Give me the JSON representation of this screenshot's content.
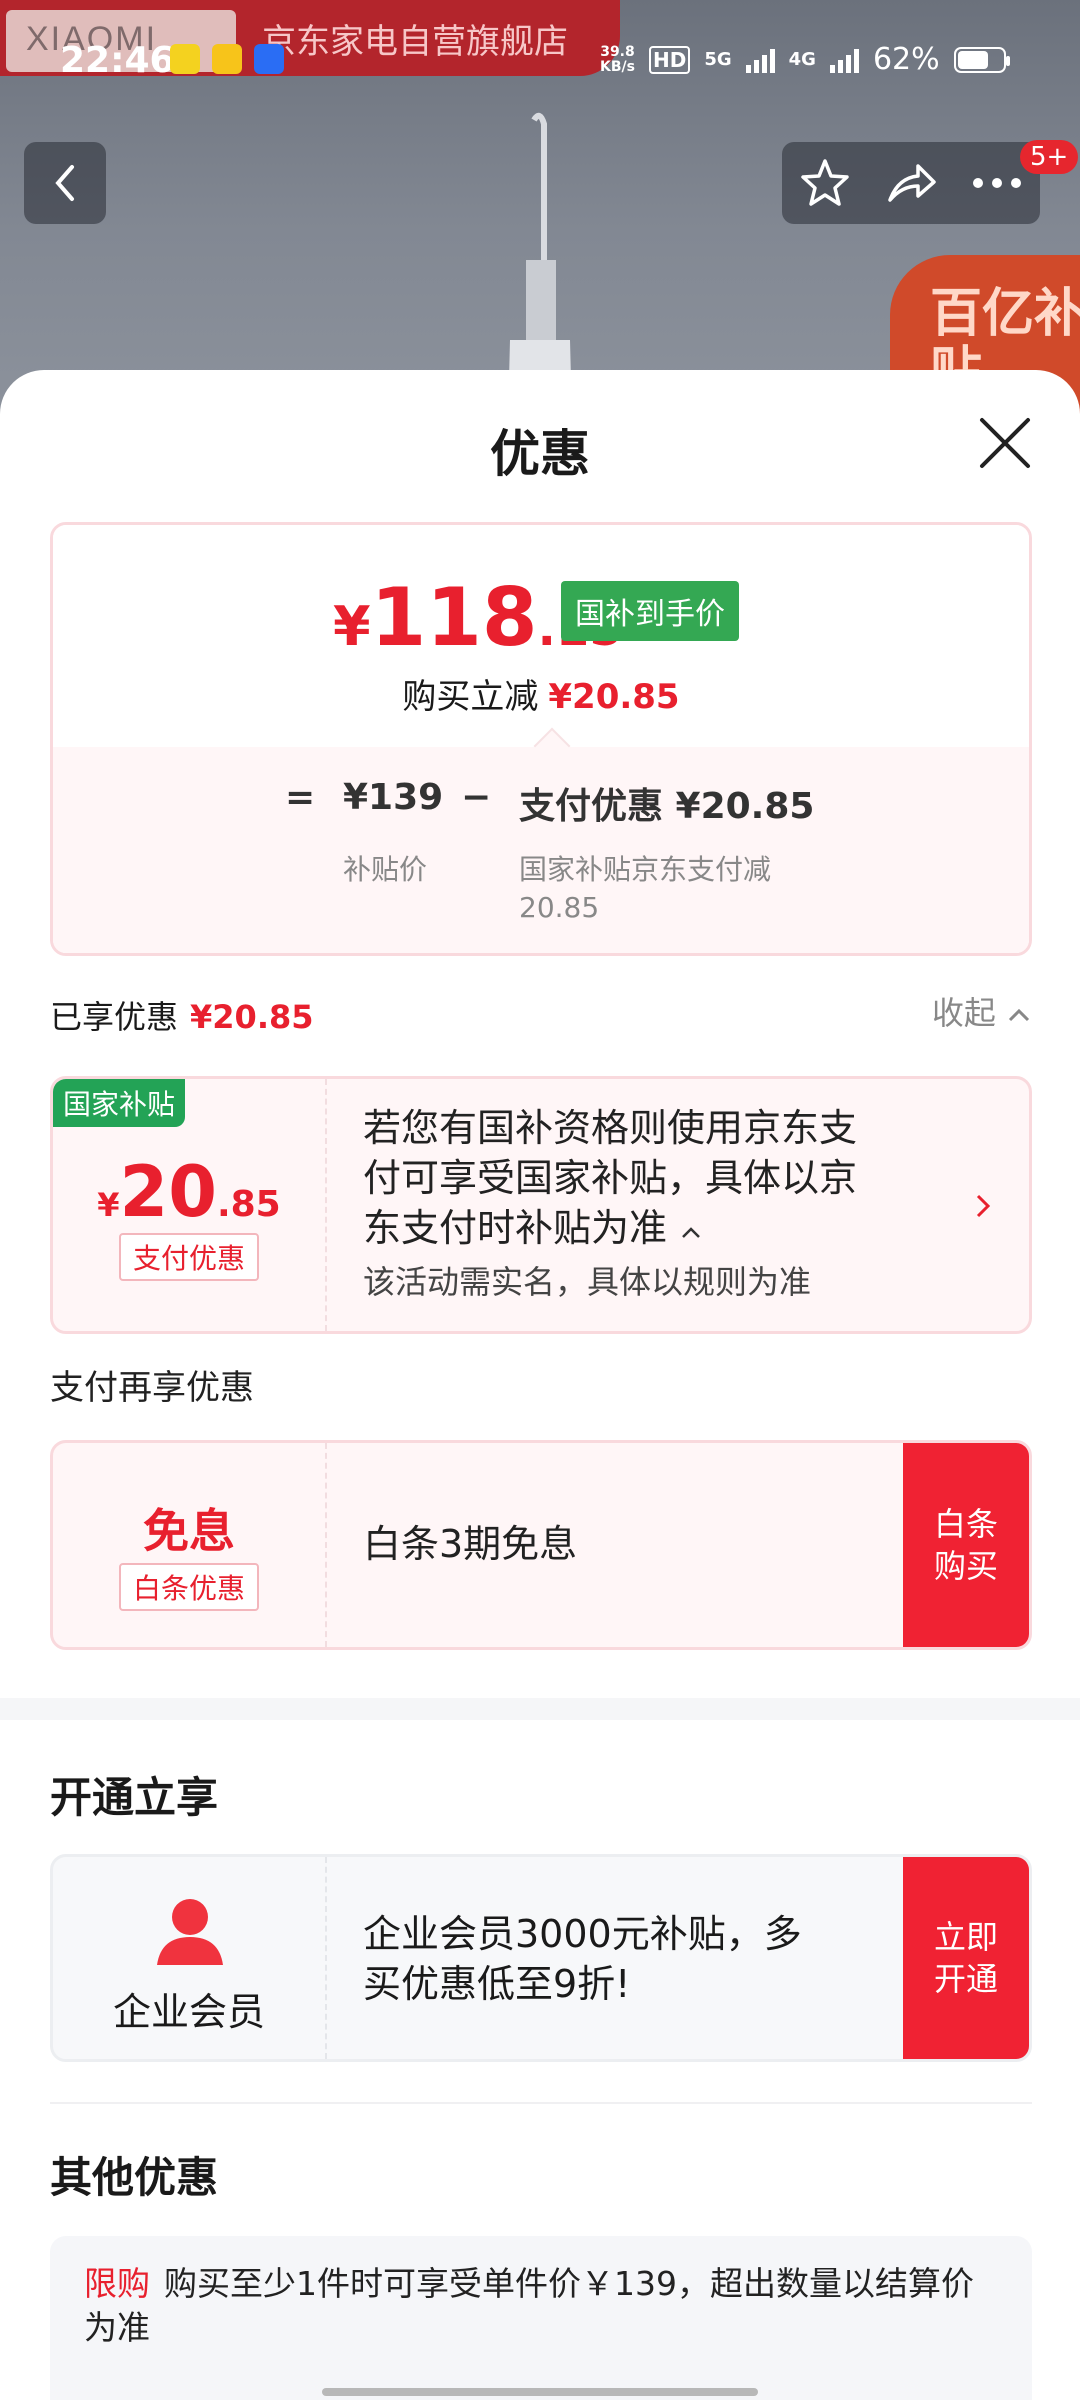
{
  "background": {
    "store_logo": "XIAOMI",
    "store_name": "京东家电自营旗舰店",
    "nav_badge": "5+",
    "seal_text": "百亿补贴"
  },
  "statusbar": {
    "time": "22:46",
    "net_speed": "39.8",
    "net_unit": "KB/s",
    "hd": "HD",
    "sim1": "5G",
    "sim2": "4G",
    "battery": "62%"
  },
  "sheet": {
    "title": "优惠"
  },
  "price_card": {
    "yen": "¥",
    "price_int": "118",
    "price_dec": ".15",
    "tag": "国补到手价",
    "cut_label": "购买立减",
    "cut_amount": "¥20.85",
    "eq": "=",
    "base_price": "¥139",
    "base_label": "补贴价",
    "minus": "−",
    "pay_discount": "支付优惠 ¥20.85",
    "pay_discount_desc_1": "国家补贴京东支付减",
    "pay_discount_desc_2": "20.85"
  },
  "enjoyed": {
    "label": "已享优惠",
    "amount": "¥20.85",
    "collapse": "收起"
  },
  "gov_deal": {
    "corner": "国家补贴",
    "yen": "¥",
    "amount_int": "20",
    "amount_dec": ".85",
    "tag": "支付优惠",
    "text_1": "若您有国补资格则使用京东支",
    "text_2": "付可享受国家补贴，具体以京",
    "text_3": "东支付时补贴为准",
    "sub": "该活动需实名，具体以规则为准"
  },
  "pay_more_label": "支付再享优惠",
  "baitiao": {
    "title": "免息",
    "tag": "白条优惠",
    "text": "白条3期免息",
    "button_1": "白条",
    "button_2": "购买"
  },
  "open_section": {
    "title": "开通立享"
  },
  "member": {
    "label": "企业会员",
    "text_1": "企业会员3000元补贴，多",
    "text_2": "买优惠低至9折!",
    "button_1": "立即",
    "button_2": "开通"
  },
  "other": {
    "title": "其他优惠",
    "tag": "限购",
    "text": "购买至少1件时可享受单件价￥139，超出数量以结算价为准"
  },
  "colors": {
    "accent_red": "#e8202e",
    "gov_green": "#34a853",
    "button_red": "#f02233"
  }
}
